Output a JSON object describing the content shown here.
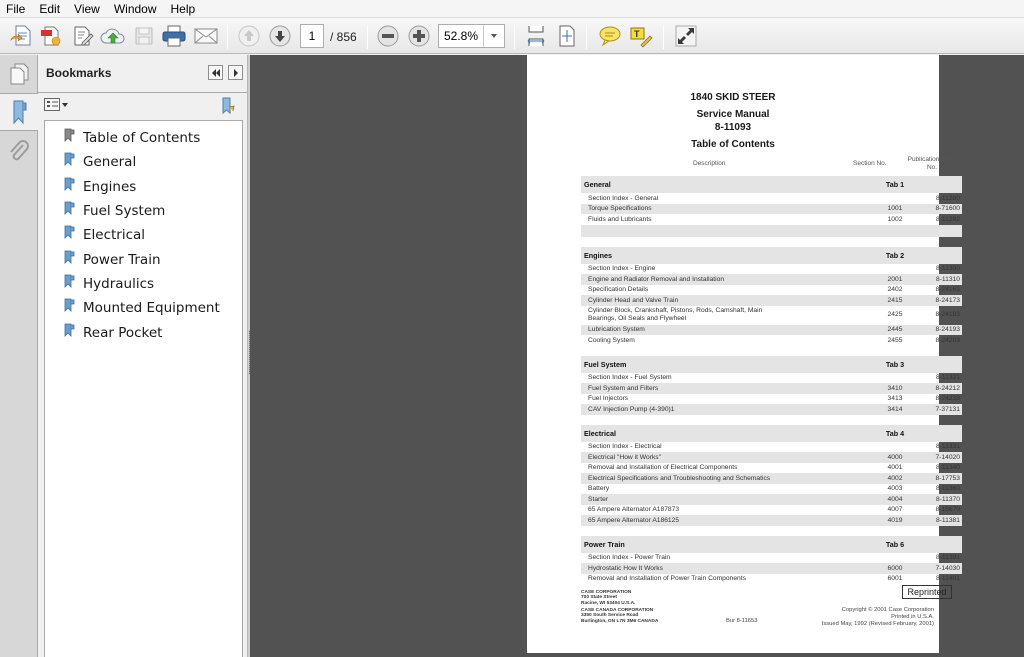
{
  "menu": [
    "File",
    "Edit",
    "View",
    "Window",
    "Help"
  ],
  "toolbar": {
    "buttons": [
      "create-pdf",
      "combine-files",
      "edit-pdf",
      "upload-cloud",
      "save",
      "print",
      "email",
      "previous-page",
      "next-page",
      "zoom-out",
      "zoom-in",
      "scrolling-mode",
      "fit-page",
      "comment",
      "highlight-text",
      "full-screen"
    ],
    "current_page": "1",
    "page_total": "/ 856",
    "zoom": "52.8%"
  },
  "panel": {
    "title": "Bookmarks",
    "bookmarks": [
      {
        "label": "Table of Contents",
        "color": "#8a8a8a"
      },
      {
        "label": "General",
        "color": "#6a9ecf"
      },
      {
        "label": "Engines",
        "color": "#6a9ecf"
      },
      {
        "label": "Fuel System",
        "color": "#6a9ecf"
      },
      {
        "label": "Electrical",
        "color": "#6a9ecf"
      },
      {
        "label": "Power Train",
        "color": "#6a9ecf"
      },
      {
        "label": "Hydraulics",
        "color": "#6a9ecf"
      },
      {
        "label": "Mounted Equipment",
        "color": "#6a9ecf"
      },
      {
        "label": "Rear Pocket",
        "color": "#6a9ecf"
      }
    ]
  },
  "document": {
    "title1": "1840 SKID STEER",
    "title2": "Service Manual",
    "title3": "8-11093",
    "title4": "Table of Contents",
    "col_description": "Description",
    "col_section": "Section No.",
    "col_pub_line1": "Publication Form",
    "col_pub_line2": "No.",
    "sections": [
      {
        "name": "General",
        "tab": "Tab 1",
        "trailing_blank": true,
        "items": [
          {
            "d": "Section Index - General",
            "s": "",
            "p": "8-11280"
          },
          {
            "d": "Torque Specifications",
            "s": "1001",
            "p": "8-71600"
          },
          {
            "d": "Fluids and Lubricants",
            "s": "1002",
            "p": "8-11292"
          }
        ]
      },
      {
        "name": "Engines",
        "tab": "Tab 2",
        "items": [
          {
            "d": "Section Index - Engine",
            "s": "",
            "p": "8-11300"
          },
          {
            "d": "Engine and Radiator Removal and Installation",
            "s": "2001",
            "p": "8-11310"
          },
          {
            "d": " Specification Details",
            "s": "2402",
            "p": "8-24163"
          },
          {
            "d": "Cylinder Head and Valve Train",
            "s": "2415",
            "p": "8-24173"
          },
          {
            "d": "Cylinder Block, Crankshaft, Pistons, Rods, Camshaft, Main Bearings, Oil Seals and Flywheel",
            "s": "2425",
            "p": "8-24183"
          },
          {
            "d": "Lubrication System",
            "s": "2445",
            "p": "8-24193"
          },
          {
            "d": "Cooling System",
            "s": "2455",
            "p": "8-24203"
          }
        ]
      },
      {
        "name": "Fuel System",
        "tab": "Tab 3",
        "items": [
          {
            "d": "Section Index - Fuel System",
            "s": "",
            "p": "8-11321"
          },
          {
            "d": "Fuel System and Filters",
            "s": "3410",
            "p": "8-24212"
          },
          {
            "d": "Fuel Injectors",
            "s": "3413",
            "p": "8-24233"
          },
          {
            "d": "CAV Injection Pump (4-390)1",
            "s": "3414",
            "p": "7-37131"
          }
        ]
      },
      {
        "name": "Electrical",
        "tab": "Tab 4",
        "items": [
          {
            "d": "Section Index - Electrical",
            "s": "",
            "p": "8-11331"
          },
          {
            "d": "Electrical \"How it Works\"",
            "s": "4000",
            "p": "7-14020"
          },
          {
            "d": "Removal and Installation of Electrical Components",
            "s": "4001",
            "p": "8-11340"
          },
          {
            "d": "Electrical Specifications and Troubleshooting and Schematics",
            "s": "4002",
            "p": "8-17753"
          },
          {
            "d": "Battery",
            "s": "4003",
            "p": "8-11360"
          },
          {
            "d": "Starter",
            "s": "4004",
            "p": "8-11370"
          },
          {
            "d": "65 Ampere Alternator A187873",
            "s": "4007",
            "p": "8-15670"
          },
          {
            "d": "65 Ampere Alternator A186125",
            "s": "4019",
            "p": "8-11381"
          }
        ]
      },
      {
        "name": "Power Train",
        "tab": "Tab 6",
        "items": [
          {
            "d": "Section Index - Power Train",
            "s": "",
            "p": "8-11391"
          },
          {
            "d": "Hydrostatic How It Works",
            "s": "6000",
            "p": "7-14030"
          },
          {
            "d": "Removal and Installation of Power Train Components",
            "s": "6001",
            "p": "8-11401"
          }
        ]
      }
    ],
    "footer": {
      "company1": [
        "CASE CORPORATION",
        "700 State Street",
        "Racine, WI 53404  U.S.A."
      ],
      "company2": [
        "CASE CANADA CORPORATION",
        "3350 South Service Road",
        "Burlington, ON L7N 3M6  CANADA"
      ],
      "bur": "Bur 8-11653",
      "reprinted": "Reprinted",
      "copyright": "Copyright © 2001 Case Corporation",
      "printed": "Printed in U.S.A.",
      "issued": "Issued May, 1992 (Revised February, 2001)"
    }
  }
}
